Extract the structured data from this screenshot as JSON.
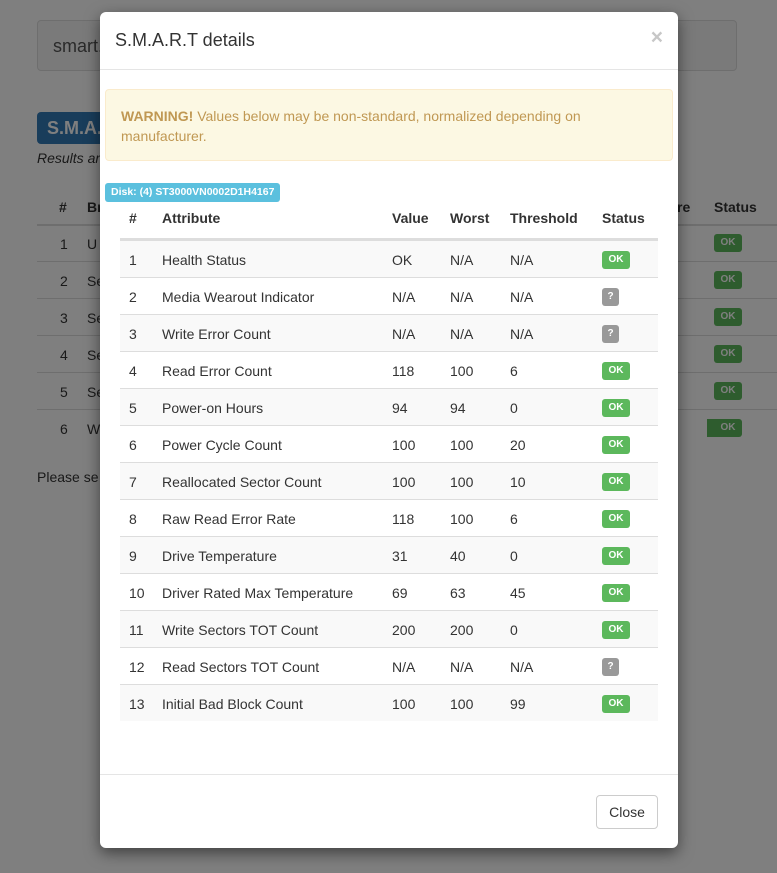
{
  "background": {
    "search_text": "smart.",
    "title_badge": "S.M.A.",
    "results_text": "Results ar",
    "headers": {
      "num": "#",
      "col2": "Br",
      "col_re": "re",
      "status": "Status"
    },
    "rows": [
      {
        "num": "1",
        "text": "U",
        "status": "OK"
      },
      {
        "num": "2",
        "text": "Se",
        "status": "OK"
      },
      {
        "num": "3",
        "text": "Se",
        "status": "OK"
      },
      {
        "num": "4",
        "text": "Se",
        "status": "OK"
      },
      {
        "num": "5",
        "text": "Se",
        "status": "OK"
      },
      {
        "num": "6",
        "text": "W",
        "status": "OK"
      }
    ],
    "please_text": "Please se"
  },
  "modal": {
    "title": "S.M.A.R.T details",
    "close_symbol": "×",
    "warning_strong": "WARNING!",
    "warning_text": " Values below may be non-standard, normalized depending on manufacturer.",
    "disk_label": "Disk: (4) ST3000VN0002D1H4167",
    "columns": {
      "num": "#",
      "attribute": "Attribute",
      "value": "Value",
      "worst": "Worst",
      "threshold": "Threshold",
      "status": "Status"
    },
    "rows": [
      {
        "num": "1",
        "attribute": "Health Status",
        "value": "OK",
        "worst": "N/A",
        "threshold": "N/A",
        "status": "OK"
      },
      {
        "num": "2",
        "attribute": "Media Wearout Indicator",
        "value": "N/A",
        "worst": "N/A",
        "threshold": "N/A",
        "status": "?"
      },
      {
        "num": "3",
        "attribute": "Write Error Count",
        "value": "N/A",
        "worst": "N/A",
        "threshold": "N/A",
        "status": "?"
      },
      {
        "num": "4",
        "attribute": "Read Error Count",
        "value": "118",
        "worst": "100",
        "threshold": "6",
        "status": "OK"
      },
      {
        "num": "5",
        "attribute": "Power-on Hours",
        "value": "94",
        "worst": "94",
        "threshold": "0",
        "status": "OK"
      },
      {
        "num": "6",
        "attribute": "Power Cycle Count",
        "value": "100",
        "worst": "100",
        "threshold": "20",
        "status": "OK"
      },
      {
        "num": "7",
        "attribute": "Reallocated Sector Count",
        "value": "100",
        "worst": "100",
        "threshold": "10",
        "status": "OK"
      },
      {
        "num": "8",
        "attribute": "Raw Read Error Rate",
        "value": "118",
        "worst": "100",
        "threshold": "6",
        "status": "OK"
      },
      {
        "num": "9",
        "attribute": "Drive Temperature",
        "value": "31",
        "worst": "40",
        "threshold": "0",
        "status": "OK"
      },
      {
        "num": "10",
        "attribute": "Driver Rated Max Temperature",
        "value": "69",
        "worst": "63",
        "threshold": "45",
        "status": "OK"
      },
      {
        "num": "11",
        "attribute": "Write Sectors TOT Count",
        "value": "200",
        "worst": "200",
        "threshold": "0",
        "status": "OK"
      },
      {
        "num": "12",
        "attribute": "Read Sectors TOT Count",
        "value": "N/A",
        "worst": "N/A",
        "threshold": "N/A",
        "status": "?"
      },
      {
        "num": "13",
        "attribute": "Initial Bad Block Count",
        "value": "100",
        "worst": "100",
        "threshold": "99",
        "status": "OK"
      }
    ],
    "close_button": "Close"
  },
  "colors": {
    "ok": "#5cb85c",
    "unknown": "#999999",
    "info": "#5bc0de",
    "warning_bg": "#fcf8e3",
    "warning_text": "#c09853",
    "primary": "#337ab7"
  }
}
